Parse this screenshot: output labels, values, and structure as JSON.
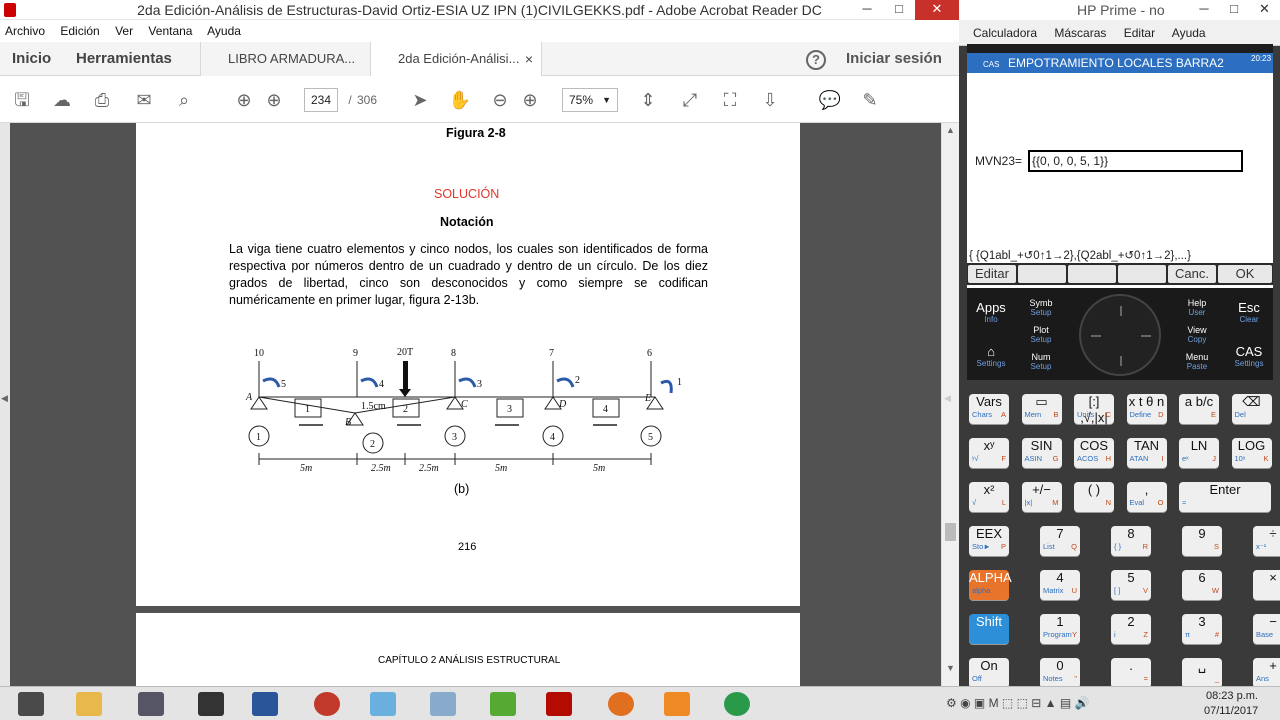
{
  "acrobat": {
    "title": "2da Edición-Análisis de Estructuras-David Ortiz-ESIA UZ IPN (1)CIVILGEKKS.pdf - Adobe Acrobat Reader DC",
    "menu": [
      "Archivo",
      "Edición",
      "Ver",
      "Ventana",
      "Ayuda"
    ],
    "tabs": {
      "home": "Inicio",
      "tools": "Herramientas",
      "doc1": "LIBRO ARMADURA...",
      "doc2": "2da Edición-Análisi...",
      "close": "×"
    },
    "help": "?",
    "signin": "Iniciar sesión",
    "toolbar": {
      "page_current": "234",
      "page_sep": "/",
      "page_total": "306",
      "zoom": "75%"
    },
    "page": {
      "figure_caption": "Figura 2-8",
      "solution": "SOLUCIÓN",
      "notation": "Notación",
      "paragraph": "La viga tiene cuatro elementos y cinco nodos, los cuales son identificados de forma respectiva por números dentro de un cuadrado y dentro de un círculo. De los diez grados de libertad, cinco son desconocidos y como siempre se codifican numéricamente en primer lugar, figura 2-13b.",
      "diagram_caption": "(b)",
      "page_number": "216",
      "next_header": "CAPÍTULO 2   ANÁLISIS ESTRUCTURAL"
    },
    "diagram": {
      "load": "20T",
      "dofs_top": [
        "10",
        "9",
        "8",
        "7",
        "6"
      ],
      "rot_labels": [
        "5",
        "4",
        "3",
        "2",
        "1"
      ],
      "nodes_letters": [
        "A",
        "B",
        "C",
        "D",
        "E"
      ],
      "elements": [
        "1",
        "2",
        "3",
        "4"
      ],
      "nodes": [
        "1",
        "2",
        "3",
        "4",
        "5"
      ],
      "spans": [
        "5m",
        "2.5m",
        "2.5m",
        "5m",
        "5m"
      ],
      "settlement": "1.5cm"
    }
  },
  "hp": {
    "title": "HP Prime - no",
    "menu": [
      "Calculadora",
      "Máscaras",
      "Editar",
      "Ayuda"
    ],
    "screen_mode": "CAS",
    "screen_title": "EMPOTRAMIENTO LOCALES BARRA2",
    "clock": "20:23",
    "input_label": "MVN23=",
    "input_value": "{{0, 0, 0, 5, 1}}",
    "hint": "{ {Q1abl_+↺0↑1→2},{Q2abl_+↺0↑1→2},...}",
    "softkeys": [
      "Editar",
      "",
      "",
      "",
      "Canc.",
      "OK"
    ],
    "nav": {
      "apps": "Apps",
      "apps_sub": "Info",
      "home_sub": "Settings",
      "symb": "Symb",
      "symb_sub": "Setup",
      "plot": "Plot",
      "plot_sub": "Setup",
      "num": "Num",
      "num_sub": "Setup",
      "help": "Help",
      "help_sub": "User",
      "view": "View",
      "view_sub": "Copy",
      "menu": "Menu",
      "menu_sub": "Paste",
      "esc": "Esc",
      "esc_sub": "Clear",
      "cas": "CAS",
      "cas_sub": "Settings"
    },
    "keys": [
      [
        {
          "m": "Vars",
          "s": "Chars",
          "t": "A"
        },
        {
          "m": "▭",
          "s": "Mem",
          "t": "B"
        },
        {
          "m": "[:] ,√,|x|",
          "s": "Units",
          "t": "C"
        },
        {
          "m": "x t θ n",
          "s": "Define",
          "t": "D"
        },
        {
          "m": "a b/c",
          "s": "",
          "t": "E"
        },
        {
          "m": "⌫",
          "s": "Del",
          "t": ""
        }
      ],
      [
        {
          "m": "xʸ",
          "s": "ʸ√",
          "t": "F"
        },
        {
          "m": "SIN",
          "s": "ASIN",
          "t": "G"
        },
        {
          "m": "COS",
          "s": "ACOS",
          "t": "H"
        },
        {
          "m": "TAN",
          "s": "ATAN",
          "t": "I"
        },
        {
          "m": "LN",
          "s": "eˣ",
          "t": "J"
        },
        {
          "m": "LOG",
          "s": "10ˣ",
          "t": "K"
        }
      ],
      [
        {
          "m": "x²",
          "s": "√",
          "t": "L"
        },
        {
          "m": "+/−",
          "s": "|x|",
          "t": "M"
        },
        {
          "m": "( )",
          "s": "",
          "t": "N"
        },
        {
          "m": ",",
          "s": "Eval",
          "t": "O"
        },
        {
          "m": "Enter",
          "s": "≈",
          "t": ""
        }
      ],
      [
        {
          "m": "EEX",
          "s": "Sto►",
          "t": "P"
        },
        {
          "m": "7",
          "s": "List",
          "t": "Q"
        },
        {
          "m": "8",
          "s": "{ }",
          "t": "R"
        },
        {
          "m": "9",
          "s": "",
          "t": "S"
        },
        {
          "m": "÷",
          "s": "x⁻¹",
          "t": "T"
        }
      ],
      [
        {
          "m": "ALPHA",
          "s": "alpha",
          "t": ""
        },
        {
          "m": "4",
          "s": "Matrix",
          "t": "U"
        },
        {
          "m": "5",
          "s": "[ ]",
          "t": "V"
        },
        {
          "m": "6",
          "s": "",
          "t": "W"
        },
        {
          "m": "×",
          "s": "",
          "t": "X"
        }
      ],
      [
        {
          "m": "Shift",
          "s": "",
          "t": ""
        },
        {
          "m": "1",
          "s": "Program",
          "t": "Y"
        },
        {
          "m": "2",
          "s": "i",
          "t": "Z"
        },
        {
          "m": "3",
          "s": "π",
          "t": "#"
        },
        {
          "m": "−",
          "s": "Base",
          "t": ":"
        }
      ],
      [
        {
          "m": "On",
          "s": "Off",
          "t": ""
        },
        {
          "m": "0",
          "s": "Notes",
          "t": "\""
        },
        {
          "m": ".",
          "s": "",
          "t": "="
        },
        {
          "m": "␣",
          "s": "",
          "t": "_"
        },
        {
          "m": "+",
          "s": "Ans",
          "t": ";"
        }
      ]
    ]
  },
  "taskbar": {
    "time": "08:23 p.m.",
    "date": "07/11/2017"
  }
}
